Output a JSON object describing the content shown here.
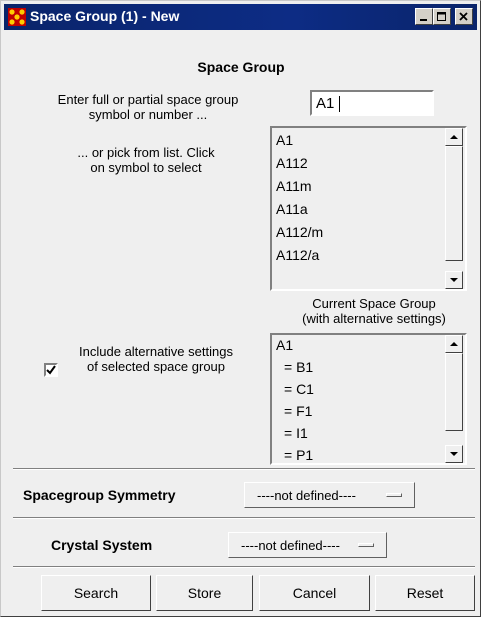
{
  "window": {
    "title": "Space Group (1) - New"
  },
  "section_title": "Space Group",
  "search": {
    "prompt_line1": "Enter full or partial space group",
    "prompt_line2": "symbol or number ...",
    "value": "A1"
  },
  "pick": {
    "line1": "... or pick from list. Click",
    "line2": "on symbol to select",
    "items": [
      "A1",
      "A112",
      "A11m",
      "A11a",
      "A112/m",
      "A112/a"
    ]
  },
  "current": {
    "label_line1": "Current Space Group",
    "label_line2": "(with alternative settings)",
    "items": [
      "A1",
      "= B1",
      "= C1",
      "= F1",
      "= I1",
      "= P1"
    ]
  },
  "alternative": {
    "checked": true,
    "label_line1": "Include alternative settings",
    "label_line2": "of selected space group"
  },
  "symmetry": {
    "label": "Spacegroup Symmetry",
    "value": "----not defined----"
  },
  "crystal": {
    "label": "Crystal System",
    "value": "----not defined----"
  },
  "buttons": {
    "search": "Search",
    "store": "Store",
    "cancel": "Cancel",
    "reset": "Reset"
  },
  "colors": {
    "titlebar": "#0a246a",
    "face": "#efefef"
  },
  "icons": {
    "app": "crystal-icon",
    "minimize": "minimize-icon",
    "maximize": "maximize-icon",
    "close": "close-icon"
  }
}
